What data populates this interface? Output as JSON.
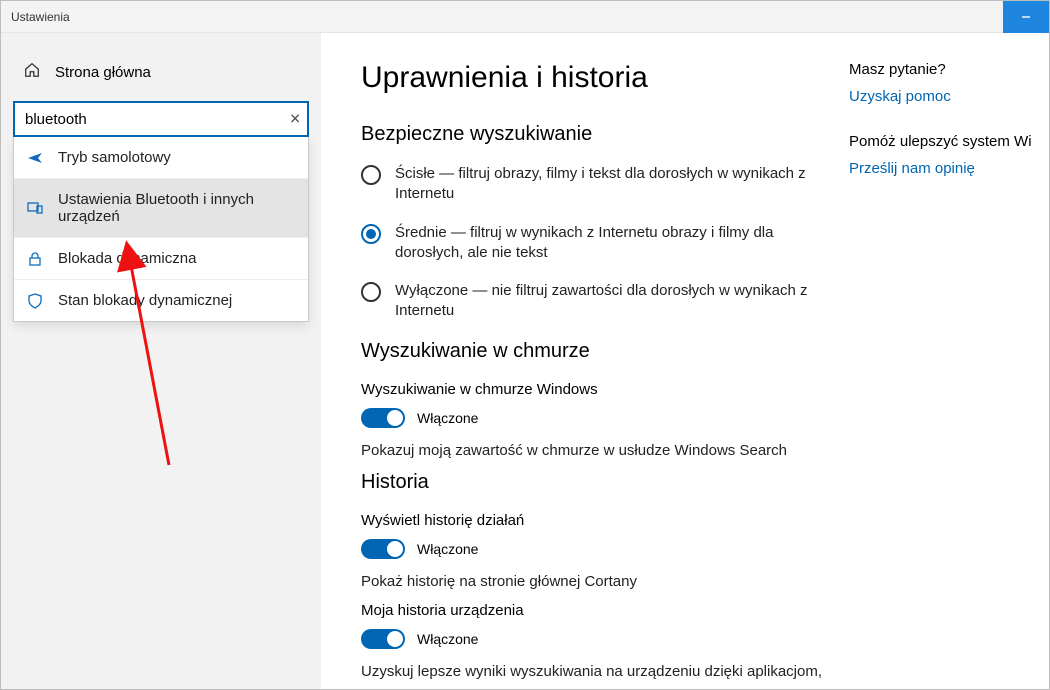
{
  "window": {
    "title": "Ustawienia"
  },
  "sidebar": {
    "home": "Strona główna",
    "search_value": "bluetooth",
    "search_clear": "✕",
    "suggestions": [
      {
        "icon": "airplane-icon",
        "label": "Tryb samolotowy"
      },
      {
        "icon": "devices-icon",
        "label": "Ustawienia Bluetooth i innych urządzeń"
      },
      {
        "icon": "lock-icon",
        "label": "Blokada dynamiczna"
      },
      {
        "icon": "shield-icon",
        "label": "Stan blokady dynamicznej"
      }
    ]
  },
  "main": {
    "title": "Uprawnienia i historia",
    "safesearch": {
      "heading": "Bezpieczne wyszukiwanie",
      "options": [
        {
          "selected": false,
          "label": "Ścisłe — filtruj obrazy, filmy i tekst dla dorosłych w wynikach z Internetu"
        },
        {
          "selected": true,
          "label": "Średnie — filtruj w wynikach z Internetu obrazy i filmy dla dorosłych, ale nie tekst"
        },
        {
          "selected": false,
          "label": "Wyłączone — nie filtruj zawartości dla dorosłych w wynikach z Internetu"
        }
      ]
    },
    "cloud": {
      "heading": "Wyszukiwanie w chmurze",
      "subhead": "Wyszukiwanie w chmurze Windows",
      "toggle_label": "Włączone",
      "desc": "Pokazuj moją zawartość w chmurze w usłudze Windows Search"
    },
    "history": {
      "heading": "Historia",
      "sub1": "Wyświetl historię działań",
      "toggle1_label": "Włączone",
      "desc1": "Pokaż historię na stronie głównej Cortany",
      "sub2": "Moja historia urządzenia",
      "toggle2_label": "Włączone",
      "desc2": "Uzyskuj lepsze wyniki wyszukiwania na urządzeniu dzięki aplikacjom,"
    }
  },
  "aside": {
    "q_heading": "Masz pytanie?",
    "q_link": "Uzyskaj pomoc",
    "f_heading": "Pomóż ulepszyć system Wi",
    "f_link": "Prześlij nam opinię"
  }
}
